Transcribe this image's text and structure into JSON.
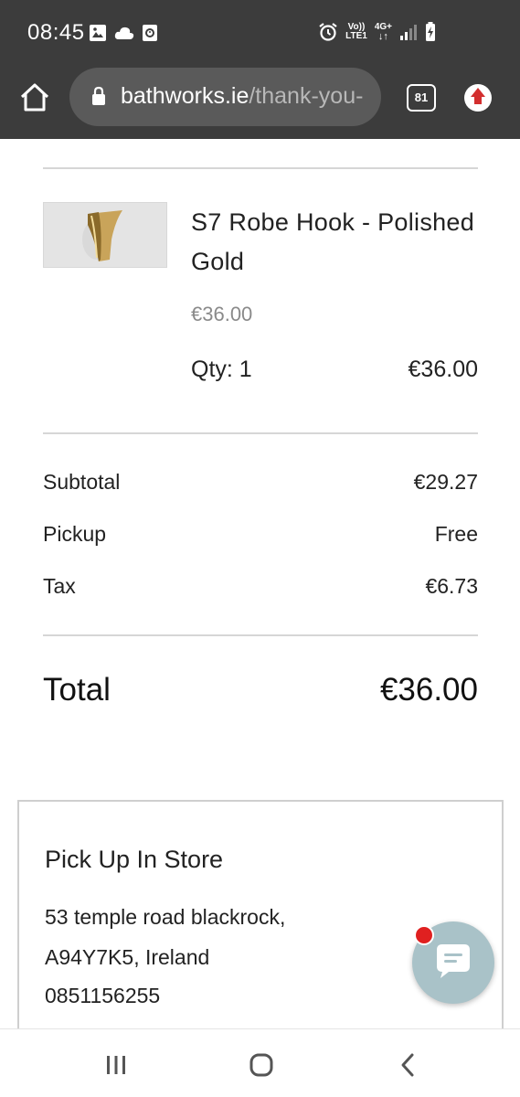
{
  "status_bar": {
    "time": "08:45",
    "network_top": "Vo))",
    "network_bottom": "LTE1",
    "data_type": "4G+",
    "icons": [
      "gallery-icon",
      "cloud-icon",
      "clock-app-icon",
      "alarm-icon",
      "signal-icon",
      "battery-charging-icon"
    ]
  },
  "browser": {
    "url_domain": "bathworks.ie",
    "url_path": "/thank-you-",
    "tab_count": "81",
    "icons": [
      "home-icon",
      "lock-icon",
      "tabs-icon",
      "upload-icon"
    ]
  },
  "order": {
    "item": {
      "name": "S7 Robe Hook - Polished Gold",
      "unit_price": "€36.00",
      "qty_label": "Qty: 1",
      "line_price": "€36.00"
    },
    "summary": [
      {
        "label": "Subtotal",
        "value": "€29.27"
      },
      {
        "label": "Pickup",
        "value": "Free"
      },
      {
        "label": "Tax",
        "value": "€6.73"
      }
    ],
    "total_label": "Total",
    "total_value": "€36.00"
  },
  "pickup": {
    "title": "Pick Up In Store",
    "address_line1": "53 temple road blackrock,",
    "address_line2": "A94Y7K5, Ireland",
    "phone": "0851156255"
  },
  "chat": {
    "icon": "chat-bubble-icon",
    "has_badge": true
  },
  "nav_bar": {
    "icons": [
      "recent-apps-icon",
      "home-nav-icon",
      "back-icon"
    ]
  },
  "colors": {
    "status_bar_bg": "#3c3c3c",
    "url_bar_bg": "#5a5a5a",
    "chat_button": "#a9c2c8",
    "badge": "#e02020",
    "divider": "#d6d6d6"
  }
}
